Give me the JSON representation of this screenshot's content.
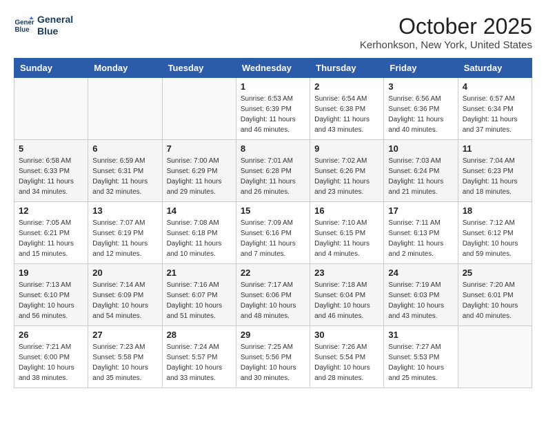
{
  "header": {
    "logo_line1": "General",
    "logo_line2": "Blue",
    "month": "October 2025",
    "location": "Kerhonkson, New York, United States"
  },
  "weekdays": [
    "Sunday",
    "Monday",
    "Tuesday",
    "Wednesday",
    "Thursday",
    "Friday",
    "Saturday"
  ],
  "weeks": [
    [
      {
        "day": "",
        "sunrise": "",
        "sunset": "",
        "daylight": ""
      },
      {
        "day": "",
        "sunrise": "",
        "sunset": "",
        "daylight": ""
      },
      {
        "day": "",
        "sunrise": "",
        "sunset": "",
        "daylight": ""
      },
      {
        "day": "1",
        "sunrise": "Sunrise: 6:53 AM",
        "sunset": "Sunset: 6:39 PM",
        "daylight": "Daylight: 11 hours and 46 minutes."
      },
      {
        "day": "2",
        "sunrise": "Sunrise: 6:54 AM",
        "sunset": "Sunset: 6:38 PM",
        "daylight": "Daylight: 11 hours and 43 minutes."
      },
      {
        "day": "3",
        "sunrise": "Sunrise: 6:56 AM",
        "sunset": "Sunset: 6:36 PM",
        "daylight": "Daylight: 11 hours and 40 minutes."
      },
      {
        "day": "4",
        "sunrise": "Sunrise: 6:57 AM",
        "sunset": "Sunset: 6:34 PM",
        "daylight": "Daylight: 11 hours and 37 minutes."
      }
    ],
    [
      {
        "day": "5",
        "sunrise": "Sunrise: 6:58 AM",
        "sunset": "Sunset: 6:33 PM",
        "daylight": "Daylight: 11 hours and 34 minutes."
      },
      {
        "day": "6",
        "sunrise": "Sunrise: 6:59 AM",
        "sunset": "Sunset: 6:31 PM",
        "daylight": "Daylight: 11 hours and 32 minutes."
      },
      {
        "day": "7",
        "sunrise": "Sunrise: 7:00 AM",
        "sunset": "Sunset: 6:29 PM",
        "daylight": "Daylight: 11 hours and 29 minutes."
      },
      {
        "day": "8",
        "sunrise": "Sunrise: 7:01 AM",
        "sunset": "Sunset: 6:28 PM",
        "daylight": "Daylight: 11 hours and 26 minutes."
      },
      {
        "day": "9",
        "sunrise": "Sunrise: 7:02 AM",
        "sunset": "Sunset: 6:26 PM",
        "daylight": "Daylight: 11 hours and 23 minutes."
      },
      {
        "day": "10",
        "sunrise": "Sunrise: 7:03 AM",
        "sunset": "Sunset: 6:24 PM",
        "daylight": "Daylight: 11 hours and 21 minutes."
      },
      {
        "day": "11",
        "sunrise": "Sunrise: 7:04 AM",
        "sunset": "Sunset: 6:23 PM",
        "daylight": "Daylight: 11 hours and 18 minutes."
      }
    ],
    [
      {
        "day": "12",
        "sunrise": "Sunrise: 7:05 AM",
        "sunset": "Sunset: 6:21 PM",
        "daylight": "Daylight: 11 hours and 15 minutes."
      },
      {
        "day": "13",
        "sunrise": "Sunrise: 7:07 AM",
        "sunset": "Sunset: 6:19 PM",
        "daylight": "Daylight: 11 hours and 12 minutes."
      },
      {
        "day": "14",
        "sunrise": "Sunrise: 7:08 AM",
        "sunset": "Sunset: 6:18 PM",
        "daylight": "Daylight: 11 hours and 10 minutes."
      },
      {
        "day": "15",
        "sunrise": "Sunrise: 7:09 AM",
        "sunset": "Sunset: 6:16 PM",
        "daylight": "Daylight: 11 hours and 7 minutes."
      },
      {
        "day": "16",
        "sunrise": "Sunrise: 7:10 AM",
        "sunset": "Sunset: 6:15 PM",
        "daylight": "Daylight: 11 hours and 4 minutes."
      },
      {
        "day": "17",
        "sunrise": "Sunrise: 7:11 AM",
        "sunset": "Sunset: 6:13 PM",
        "daylight": "Daylight: 11 hours and 2 minutes."
      },
      {
        "day": "18",
        "sunrise": "Sunrise: 7:12 AM",
        "sunset": "Sunset: 6:12 PM",
        "daylight": "Daylight: 10 hours and 59 minutes."
      }
    ],
    [
      {
        "day": "19",
        "sunrise": "Sunrise: 7:13 AM",
        "sunset": "Sunset: 6:10 PM",
        "daylight": "Daylight: 10 hours and 56 minutes."
      },
      {
        "day": "20",
        "sunrise": "Sunrise: 7:14 AM",
        "sunset": "Sunset: 6:09 PM",
        "daylight": "Daylight: 10 hours and 54 minutes."
      },
      {
        "day": "21",
        "sunrise": "Sunrise: 7:16 AM",
        "sunset": "Sunset: 6:07 PM",
        "daylight": "Daylight: 10 hours and 51 minutes."
      },
      {
        "day": "22",
        "sunrise": "Sunrise: 7:17 AM",
        "sunset": "Sunset: 6:06 PM",
        "daylight": "Daylight: 10 hours and 48 minutes."
      },
      {
        "day": "23",
        "sunrise": "Sunrise: 7:18 AM",
        "sunset": "Sunset: 6:04 PM",
        "daylight": "Daylight: 10 hours and 46 minutes."
      },
      {
        "day": "24",
        "sunrise": "Sunrise: 7:19 AM",
        "sunset": "Sunset: 6:03 PM",
        "daylight": "Daylight: 10 hours and 43 minutes."
      },
      {
        "day": "25",
        "sunrise": "Sunrise: 7:20 AM",
        "sunset": "Sunset: 6:01 PM",
        "daylight": "Daylight: 10 hours and 40 minutes."
      }
    ],
    [
      {
        "day": "26",
        "sunrise": "Sunrise: 7:21 AM",
        "sunset": "Sunset: 6:00 PM",
        "daylight": "Daylight: 10 hours and 38 minutes."
      },
      {
        "day": "27",
        "sunrise": "Sunrise: 7:23 AM",
        "sunset": "Sunset: 5:58 PM",
        "daylight": "Daylight: 10 hours and 35 minutes."
      },
      {
        "day": "28",
        "sunrise": "Sunrise: 7:24 AM",
        "sunset": "Sunset: 5:57 PM",
        "daylight": "Daylight: 10 hours and 33 minutes."
      },
      {
        "day": "29",
        "sunrise": "Sunrise: 7:25 AM",
        "sunset": "Sunset: 5:56 PM",
        "daylight": "Daylight: 10 hours and 30 minutes."
      },
      {
        "day": "30",
        "sunrise": "Sunrise: 7:26 AM",
        "sunset": "Sunset: 5:54 PM",
        "daylight": "Daylight: 10 hours and 28 minutes."
      },
      {
        "day": "31",
        "sunrise": "Sunrise: 7:27 AM",
        "sunset": "Sunset: 5:53 PM",
        "daylight": "Daylight: 10 hours and 25 minutes."
      },
      {
        "day": "",
        "sunrise": "",
        "sunset": "",
        "daylight": ""
      }
    ]
  ]
}
